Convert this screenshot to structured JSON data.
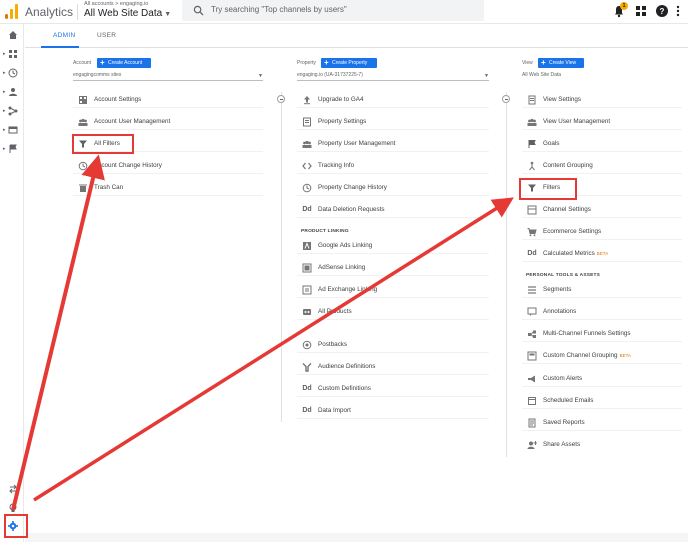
{
  "header": {
    "app_name": "Analytics",
    "account_breadcrumb": "All accounts > engaging.io",
    "view_selector": "All Web Site Data",
    "search_placeholder": "Try searching \"Top channels by users\"",
    "notification_count": "1"
  },
  "tabs": [
    {
      "label": "ADMIN",
      "active": true
    },
    {
      "label": "USER",
      "active": false
    }
  ],
  "account": {
    "heading": "Account",
    "create_label": "Create Account",
    "selected": "engagingcomms sites",
    "items": [
      {
        "icon": "building-icon",
        "label": "Account Settings"
      },
      {
        "icon": "users-icon",
        "label": "Account User Management"
      },
      {
        "icon": "filter-icon",
        "label": "All Filters"
      },
      {
        "icon": "history-icon",
        "label": "Account Change History"
      },
      {
        "icon": "trash-icon",
        "label": "Trash Can"
      }
    ]
  },
  "property": {
    "heading": "Property",
    "create_label": "Create Property",
    "selected": "engaging.io (UA-31737225-7)",
    "items": [
      {
        "icon": "upgrade-icon",
        "label": "Upgrade to GA4"
      },
      {
        "icon": "settings-page-icon",
        "label": "Property Settings"
      },
      {
        "icon": "users-icon",
        "label": "Property User Management"
      },
      {
        "icon": "code-icon",
        "label": "Tracking Info"
      },
      {
        "icon": "history-icon",
        "label": "Property Change History"
      },
      {
        "icon": "dd-icon",
        "label": "Data Deletion Requests"
      }
    ],
    "linking_heading": "PRODUCT LINKING",
    "linking_items": [
      {
        "icon": "google-ads-icon",
        "label": "Google Ads Linking"
      },
      {
        "icon": "adsense-icon",
        "label": "AdSense Linking"
      },
      {
        "icon": "ad-exchange-icon",
        "label": "Ad Exchange Linking"
      },
      {
        "icon": "products-icon",
        "label": "All Products"
      }
    ],
    "more_items": [
      {
        "icon": "postbacks-icon",
        "label": "Postbacks"
      },
      {
        "icon": "audience-icon",
        "label": "Audience Definitions"
      },
      {
        "icon": "dd-icon",
        "label": "Custom Definitions"
      },
      {
        "icon": "dd-icon",
        "label": "Data Import"
      }
    ]
  },
  "view": {
    "heading": "View",
    "create_label": "Create View",
    "selected": "All Web Site Data",
    "items": [
      {
        "icon": "document-icon",
        "label": "View Settings"
      },
      {
        "icon": "users-icon",
        "label": "View User Management"
      },
      {
        "icon": "flag-icon",
        "label": "Goals"
      },
      {
        "icon": "content-grouping-icon",
        "label": "Content Grouping"
      },
      {
        "icon": "filter-icon",
        "label": "Filters"
      },
      {
        "icon": "channel-settings-icon",
        "label": "Channel Settings"
      },
      {
        "icon": "cart-icon",
        "label": "Ecommerce Settings"
      },
      {
        "icon": "dd-icon",
        "label": "Calculated Metrics",
        "beta": "BETA"
      }
    ],
    "personal_heading": "PERSONAL TOOLS & ASSETS",
    "personal_items": [
      {
        "icon": "segments-icon",
        "label": "Segments"
      },
      {
        "icon": "annotations-icon",
        "label": "Annotations"
      },
      {
        "icon": "multichannel-icon",
        "label": "Multi-Channel Funnels Settings"
      },
      {
        "icon": "channel-grouping-icon",
        "label": "Custom Channel Grouping",
        "beta": "BETA"
      },
      {
        "icon": "megaphone-icon",
        "label": "Custom Alerts"
      },
      {
        "icon": "scheduled-email-icon",
        "label": "Scheduled Emails"
      },
      {
        "icon": "saved-reports-icon",
        "label": "Saved Reports"
      },
      {
        "icon": "share-icon",
        "label": "Share Assets"
      }
    ]
  },
  "colors": {
    "accent": "#1a73e8",
    "annotation_red": "#e53935",
    "beta": "#e37400",
    "logo_orange": "#f9ab00",
    "logo_dark_orange": "#e37400"
  }
}
